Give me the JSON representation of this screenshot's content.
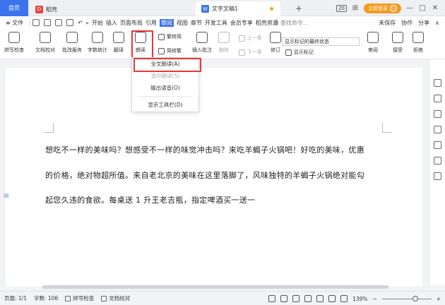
{
  "tabs": {
    "home": "首页",
    "app_tab": "稻壳",
    "app_logo_letter": "D",
    "doc_tab": "文字文稿1",
    "doc_logo_letter": "W",
    "new_tab": "+"
  },
  "window": {
    "badge": "20",
    "grid_icon": "⊞",
    "login_label": "立即登录",
    "min_icon": "—",
    "max_icon": "□",
    "close_icon": "✕"
  },
  "menubar": {
    "file": "≡ 文件",
    "undo_icon": "↶",
    "more": "»",
    "tabs": [
      "开始",
      "插入",
      "页面布局",
      "引用",
      "审阅",
      "视图",
      "章节",
      "开发工具",
      "会员专享",
      "稻壳资源"
    ],
    "active_tab": "审阅",
    "search": "Q 查找命令...",
    "unsaved": "未保存",
    "collab": "协作",
    "share": "分享",
    "collapse_icon": "∧"
  },
  "ribbon": {
    "spellcheck": "拼写检查",
    "doc_proof": "文档校对",
    "batch": "批改服务",
    "wordcount": "字数统计",
    "translate": "翻译",
    "read_aloud": "朗读",
    "to_simplified": "繁转简",
    "to_traditional": "简转繁",
    "insert_comment": "插入批注",
    "delete": "删除",
    "prev": "上一条",
    "next": "下一条",
    "track": "修订",
    "show_final": "显示标记的最终状态",
    "show_marks": "显示标记",
    "review": "审阅",
    "accept": "接受",
    "reject": "拒绝"
  },
  "dropdown": {
    "items": [
      {
        "label": "全文朗读(A)",
        "enabled": true
      },
      {
        "label": "选中朗读(S)",
        "enabled": false
      },
      {
        "label": "输出语音(O)",
        "enabled": true
      },
      {
        "label": "显示工具栏(D)",
        "enabled": true
      }
    ]
  },
  "document": {
    "lines": [
      "想吃不一样的美味吗？想感受不一样的味觉冲击吗？来吃羊蝎子火锅吧！好吃的美味，优惠",
      "的价格，绝对物超所值。来自老北京的美味在这里落脚了，风味独特的羊蝎子火锅绝对能勾",
      "起您久违的食欲。每桌送 1 升王老吉瓶，指定啤酒买一送一"
    ]
  },
  "statusbar": {
    "page": "页面: 1/1",
    "words": "字数: 106",
    "spell": "拼写检查",
    "proof": "文档校对",
    "zoom": "139%",
    "zoom_level_percent": 139,
    "minus": "−",
    "plus": "+"
  }
}
